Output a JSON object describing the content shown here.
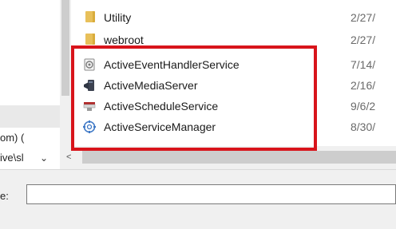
{
  "left_pane": {
    "text1": "om) (",
    "text2": "ive\\sl",
    "dropdown_glyph": "⌄"
  },
  "file_list": {
    "rows": [
      {
        "name": "Utility",
        "date": "2/27/",
        "icon": "folder-icon"
      },
      {
        "name": "webroot",
        "date": "2/27/",
        "icon": "folder-icon"
      },
      {
        "name": "ActiveEventHandlerService",
        "date": "7/14/",
        "icon": "event-handler-service-icon"
      },
      {
        "name": "ActiveMediaServer",
        "date": "2/16/",
        "icon": "media-server-icon"
      },
      {
        "name": "ActiveScheduleService",
        "date": "9/6/2",
        "icon": "schedule-service-icon"
      },
      {
        "name": "ActiveServiceManager",
        "date": "8/30/",
        "icon": "service-manager-icon"
      }
    ]
  },
  "scroll_left_glyph": "<",
  "file_name": {
    "label": "e:",
    "value": ""
  },
  "colors": {
    "highlight": "#d8141b",
    "folder": "#e8c05a"
  }
}
